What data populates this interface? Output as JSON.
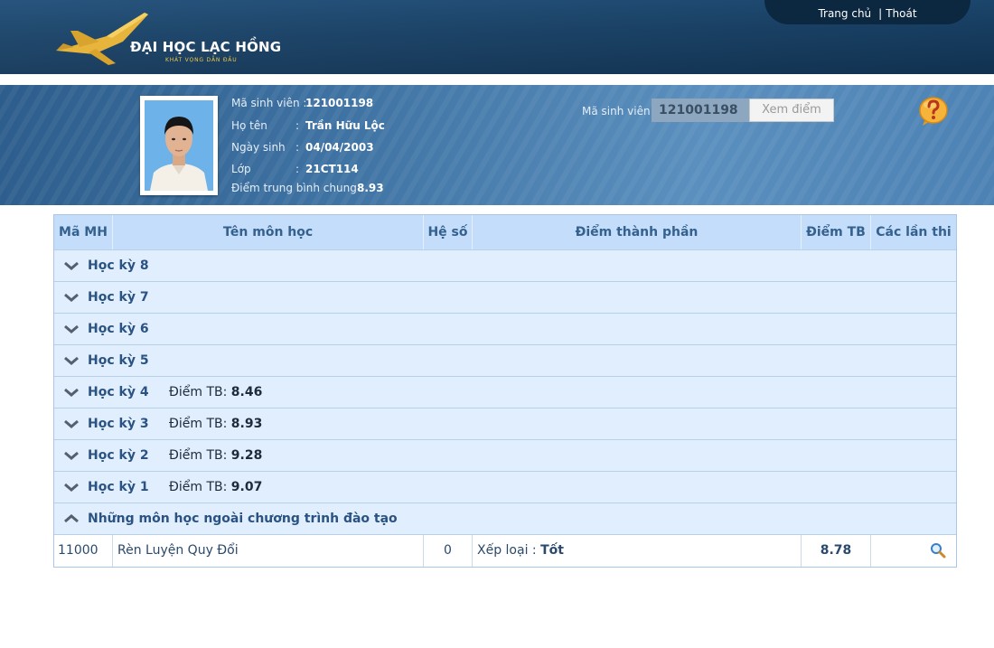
{
  "header": {
    "logo_title": "ĐẠI HỌC LẠC HỒNG",
    "logo_slogan": "KHÁT VỌNG DẪN ĐẦU",
    "nav": {
      "home": "Trang chủ",
      "separator": "|",
      "logout": "Thoát"
    }
  },
  "student": {
    "id_label": "Mã sinh viên :",
    "id": "121001198",
    "name_label": "Họ tên",
    "name": "Trần Hữu Lộc",
    "dob_label": "Ngày sinh",
    "dob": "04/04/2003",
    "class_label": "Lớp",
    "class": "21CT114",
    "gpa_label": "Điểm trung bình chung :",
    "gpa": "8.93",
    "colon": ":"
  },
  "search": {
    "label": "Mã sinh viên",
    "value": "121001198",
    "button": "Xem điểm"
  },
  "table": {
    "columns": [
      "Mã MH",
      "Tên môn học",
      "Hệ số",
      "Điểm thành phần",
      "Điểm TB",
      "Các lần thi"
    ],
    "avg_label": "Điểm TB:",
    "terms": [
      {
        "name": "Học kỳ 8",
        "avg": ""
      },
      {
        "name": "Học kỳ 7",
        "avg": ""
      },
      {
        "name": "Học kỳ 6",
        "avg": ""
      },
      {
        "name": "Học kỳ 5",
        "avg": ""
      },
      {
        "name": "Học kỳ 4",
        "avg": "8.46"
      },
      {
        "name": "Học kỳ 3",
        "avg": "8.93"
      },
      {
        "name": "Học kỳ 2",
        "avg": "9.28"
      },
      {
        "name": "Học kỳ 1",
        "avg": "9.07"
      }
    ],
    "extra_group": "Những môn học ngoài chương trình đào tạo",
    "extra_courses": [
      {
        "code": "11000",
        "name": "Rèn Luyện Quy Đổi",
        "coef": "0",
        "component_label": "Xếp loại :",
        "component_value": "Tốt",
        "avg": "8.78",
        "attempts_icon": "magnifier-icon"
      }
    ]
  },
  "colors": {
    "header_bg": "#184268",
    "banner_bg": "#3f73a3",
    "table_header_bg": "#c4ddfa",
    "term_row_bg": "#e1eefd",
    "accent_text": "#2a5282",
    "logo_gold": "#e7b53c"
  }
}
